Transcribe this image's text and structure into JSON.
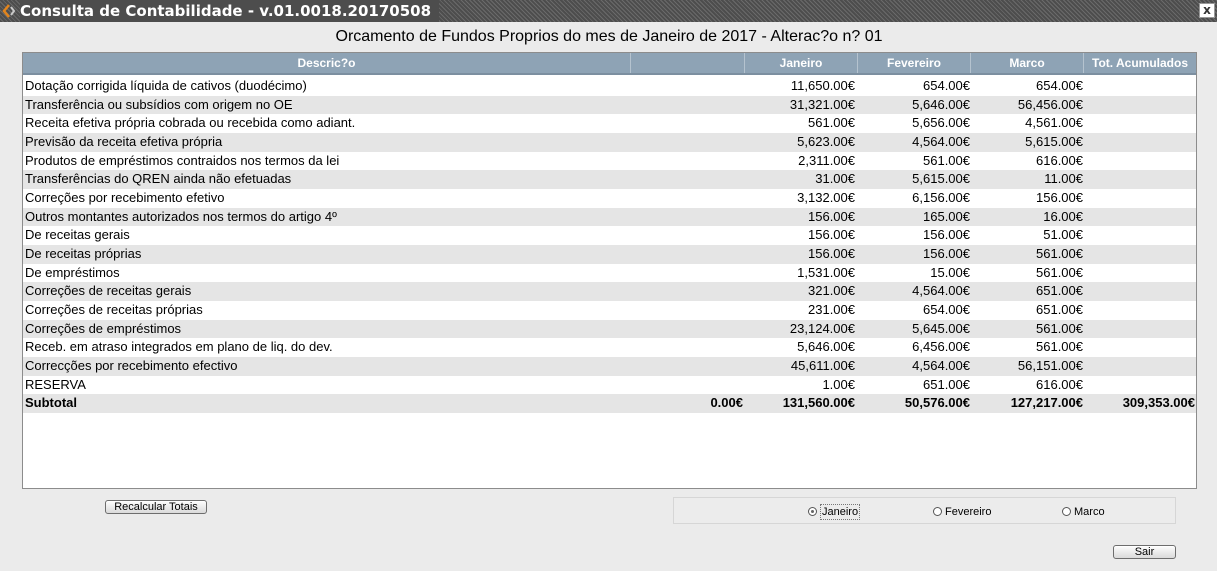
{
  "window": {
    "title": "Consulta de Contabilidade - v.01.0018.20170508",
    "close_label": "x"
  },
  "page_title": "Orcamento de Fundos Proprios do mes de Janeiro de 2017 - Alterac?o n? 01",
  "table": {
    "headers": {
      "descricao": "Descric?o",
      "blank": "",
      "janeiro": "Janeiro",
      "fevereiro": "Fevereiro",
      "marco": "Marco",
      "tot": "Tot. Acumulados"
    },
    "rows": [
      {
        "desc": "Dotação corrigida líquida de cativos (duodécimo)",
        "blank": "",
        "jan": "11,650.00€",
        "fev": "654.00€",
        "mar": "654.00€",
        "tot": ""
      },
      {
        "desc": "Transferência ou subsídios com origem no OE",
        "blank": "",
        "jan": "31,321.00€",
        "fev": "5,646.00€",
        "mar": "56,456.00€",
        "tot": ""
      },
      {
        "desc": "Receita efetiva própria cobrada ou recebida como adiant.",
        "blank": "",
        "jan": "561.00€",
        "fev": "5,656.00€",
        "mar": "4,561.00€",
        "tot": ""
      },
      {
        "desc": "Previsão da receita efetiva própria",
        "blank": "",
        "jan": "5,623.00€",
        "fev": "4,564.00€",
        "mar": "5,615.00€",
        "tot": ""
      },
      {
        "desc": "Produtos de empréstimos contraidos nos termos da lei",
        "blank": "",
        "jan": "2,311.00€",
        "fev": "561.00€",
        "mar": "616.00€",
        "tot": ""
      },
      {
        "desc": "Transferências do QREN ainda não efetuadas",
        "blank": "",
        "jan": "31.00€",
        "fev": "5,615.00€",
        "mar": "11.00€",
        "tot": ""
      },
      {
        "desc": "Correções por recebimento efetivo",
        "blank": "",
        "jan": "3,132.00€",
        "fev": "6,156.00€",
        "mar": "156.00€",
        "tot": ""
      },
      {
        "desc": "Outros montantes autorizados nos termos do artigo 4º",
        "blank": "",
        "jan": "156.00€",
        "fev": "165.00€",
        "mar": "16.00€",
        "tot": ""
      },
      {
        "desc": "De receitas gerais",
        "blank": "",
        "jan": "156.00€",
        "fev": "156.00€",
        "mar": "51.00€",
        "tot": ""
      },
      {
        "desc": "De receitas próprias",
        "blank": "",
        "jan": "156.00€",
        "fev": "156.00€",
        "mar": "561.00€",
        "tot": ""
      },
      {
        "desc": "De empréstimos",
        "blank": "",
        "jan": "1,531.00€",
        "fev": "15.00€",
        "mar": "561.00€",
        "tot": ""
      },
      {
        "desc": "Correções de receitas gerais",
        "blank": "",
        "jan": "321.00€",
        "fev": "4,564.00€",
        "mar": "651.00€",
        "tot": ""
      },
      {
        "desc": "Correções de receitas próprias",
        "blank": "",
        "jan": "231.00€",
        "fev": "654.00€",
        "mar": "651.00€",
        "tot": ""
      },
      {
        "desc": "Correções de empréstimos",
        "blank": "",
        "jan": "23,124.00€",
        "fev": "5,645.00€",
        "mar": "561.00€",
        "tot": ""
      },
      {
        "desc": "Receb. em atraso integrados em plano de liq. do dev.",
        "blank": "",
        "jan": "5,646.00€",
        "fev": "6,456.00€",
        "mar": "561.00€",
        "tot": ""
      },
      {
        "desc": "Correcções por recebimento efectivo",
        "blank": "",
        "jan": "45,611.00€",
        "fev": "4,564.00€",
        "mar": "56,151.00€",
        "tot": ""
      },
      {
        "desc": "RESERVA",
        "blank": "",
        "jan": "1.00€",
        "fev": "651.00€",
        "mar": "616.00€",
        "tot": ""
      }
    ],
    "subtotal": {
      "desc": "Subtotal",
      "blank": "0.00€",
      "jan": "131,560.00€",
      "fev": "50,576.00€",
      "mar": "127,217.00€",
      "tot": "309,353.00€"
    }
  },
  "buttons": {
    "recalcular": "Recalcular Totais",
    "sair": "Sair"
  },
  "month_selector": {
    "options": [
      "Janeiro",
      "Fevereiro",
      "Marco"
    ],
    "selected": "Janeiro"
  },
  "colors": {
    "header_bg": "#8ea3b5",
    "alt_row": "#e5e5e5",
    "titlebar": "#4d4d4d"
  },
  "icons": {
    "app": "app-logo-icon",
    "close": "close-icon"
  }
}
